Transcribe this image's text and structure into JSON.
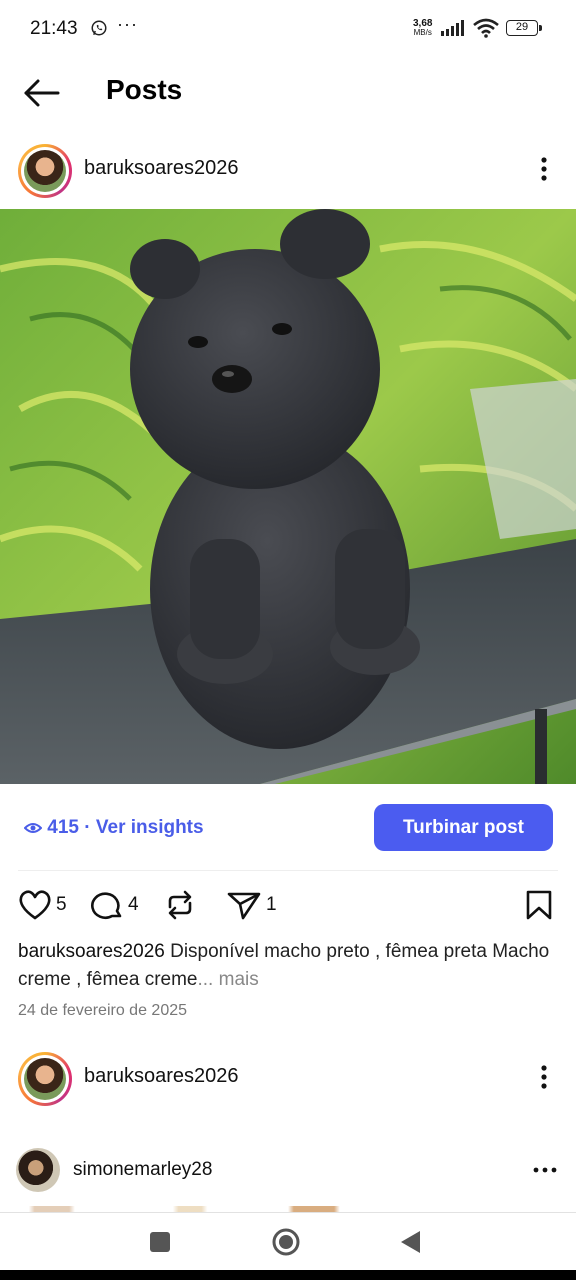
{
  "status_bar": {
    "time": "21:43",
    "dots": "···",
    "speed_value": "3,68",
    "speed_unit": "MB/s",
    "battery": "29"
  },
  "header": {
    "title": "Posts",
    "back_icon": "arrow-left-icon"
  },
  "post": {
    "username": "baruksoares2026",
    "menu_icon": "more-vertical-icon",
    "image_subject": "black chow chow puppy on table with palm leaves",
    "insights": {
      "icon": "eye-icon",
      "views": "415",
      "link_label": "· Ver insights"
    },
    "boost_label": "Turbinar post",
    "actions": {
      "likes": "5",
      "comments": "4",
      "shares": "1"
    },
    "caption_username": "baruksoares2026",
    "caption_text": " Disponível macho preto , fêmea preta Macho creme , fêmea creme",
    "caption_more": "... mais",
    "date": "24 de fevereiro de 2025"
  },
  "next_post": {
    "username": "baruksoares2026"
  },
  "suggested_post": {
    "username": "simonemarley28"
  },
  "colors": {
    "accent": "#4b5cf0",
    "link": "#4a5de8"
  }
}
